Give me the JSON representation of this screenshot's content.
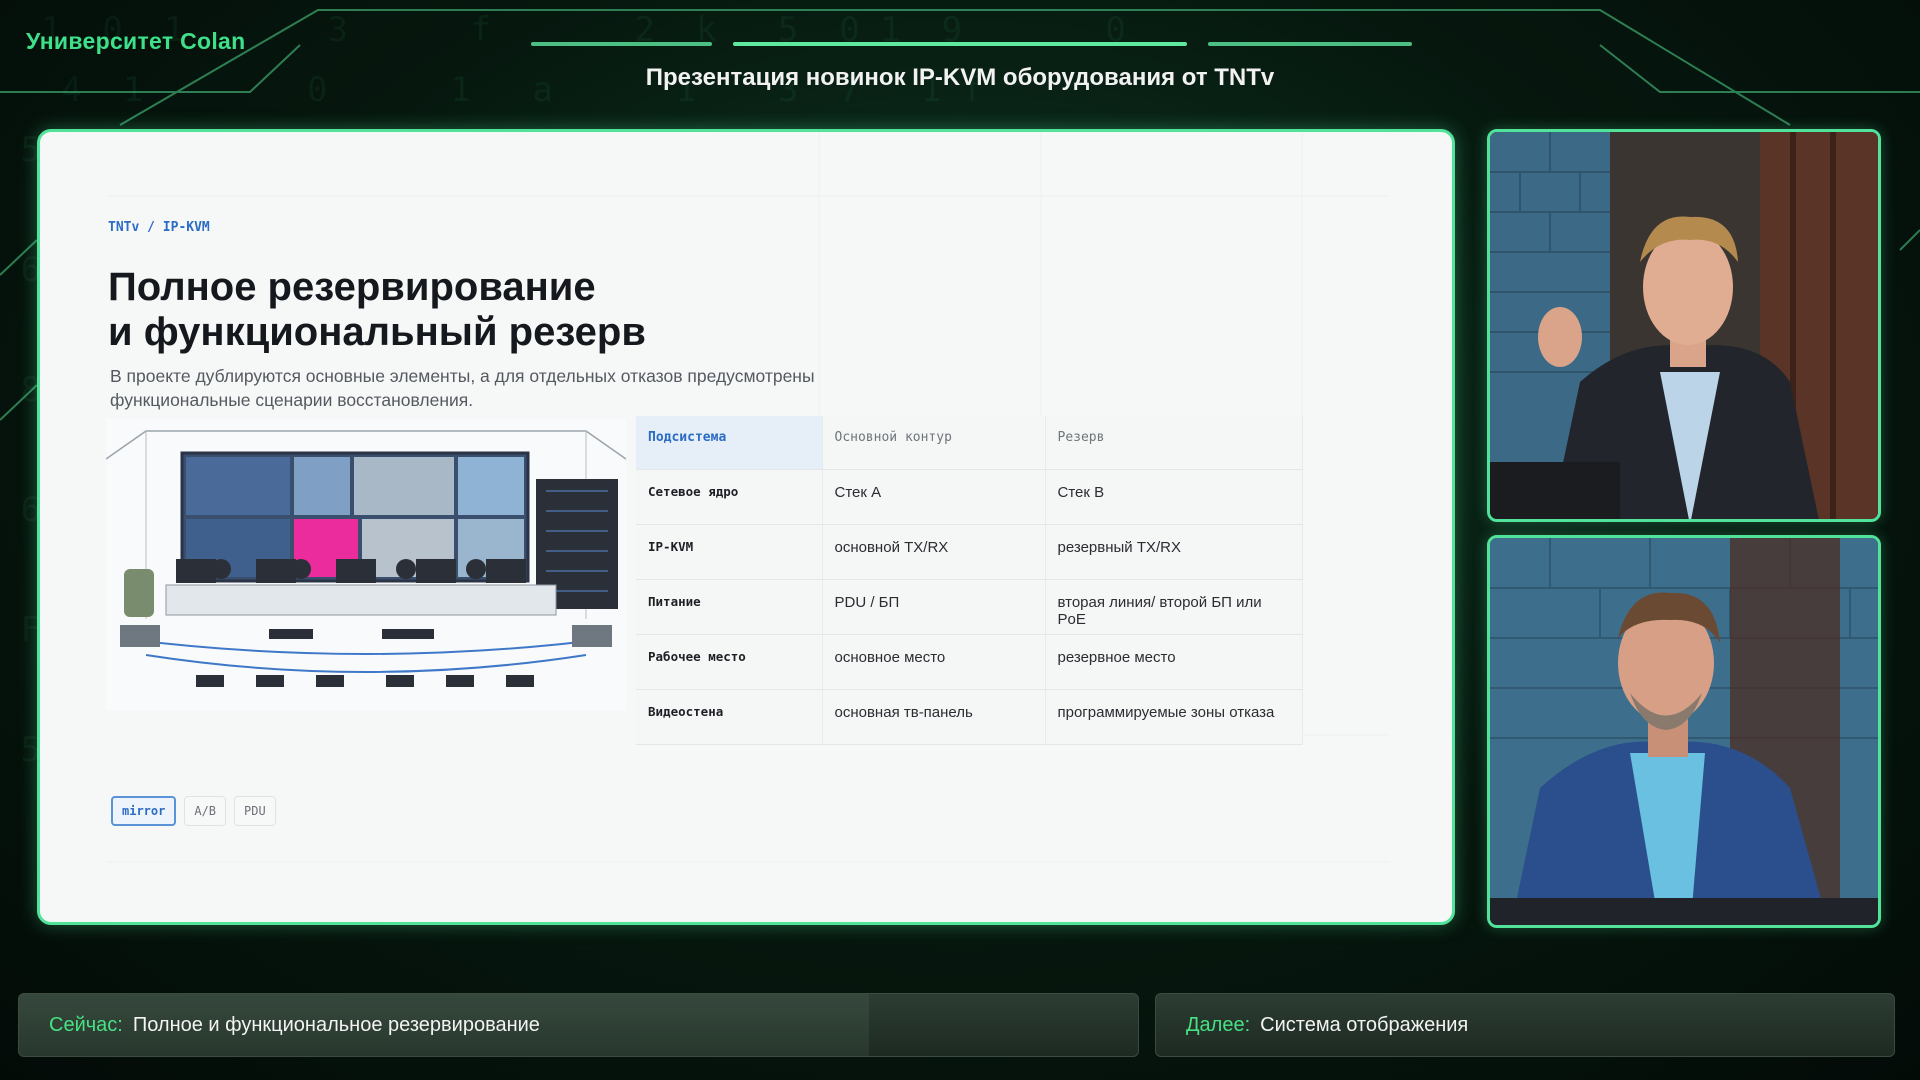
{
  "brand": {
    "name": "Университет Colan"
  },
  "header": {
    "title": "Презентация новинок IP-KVM оборудования от TNTv"
  },
  "slide": {
    "breadcrumb": "TNTv / IP-KVM",
    "title_line1": "Полное резервирование",
    "title_line2": "и функциональный резерв",
    "lead": "В проекте дублируются основные элементы, а для отдельных отказов предусмотрены функциональные сценарии восстановления.",
    "table": {
      "headers": [
        "Подсистема",
        "Основной контур",
        "Резерв"
      ],
      "rows": [
        [
          "Сетевое ядро",
          "Стек A",
          "Стек B"
        ],
        [
          "IP-KVM",
          "основной TX/RX",
          "резервный TX/RX"
        ],
        [
          "Питание",
          "PDU / БП",
          "вторая линия/ второй БП или PoE"
        ],
        [
          "Рабочее место",
          "основное место",
          "резервное место"
        ],
        [
          "Видеостена",
          "основная тв-панель",
          "программируемые зоны отказа"
        ]
      ]
    },
    "chips": [
      "mirror",
      "A/B",
      "PDU"
    ],
    "colors": {
      "accent": "#2b6cc4",
      "frame": "#52e39a",
      "highlight": "#ea2c9c"
    }
  },
  "ticker": {
    "now_label": "Сейчас:",
    "now_text": "Полное и функциональное резервирование",
    "next_label": "Далее:",
    "next_text": "Система отображения"
  },
  "icons": [
    "control-room-illustration",
    "presenter-camera"
  ]
}
